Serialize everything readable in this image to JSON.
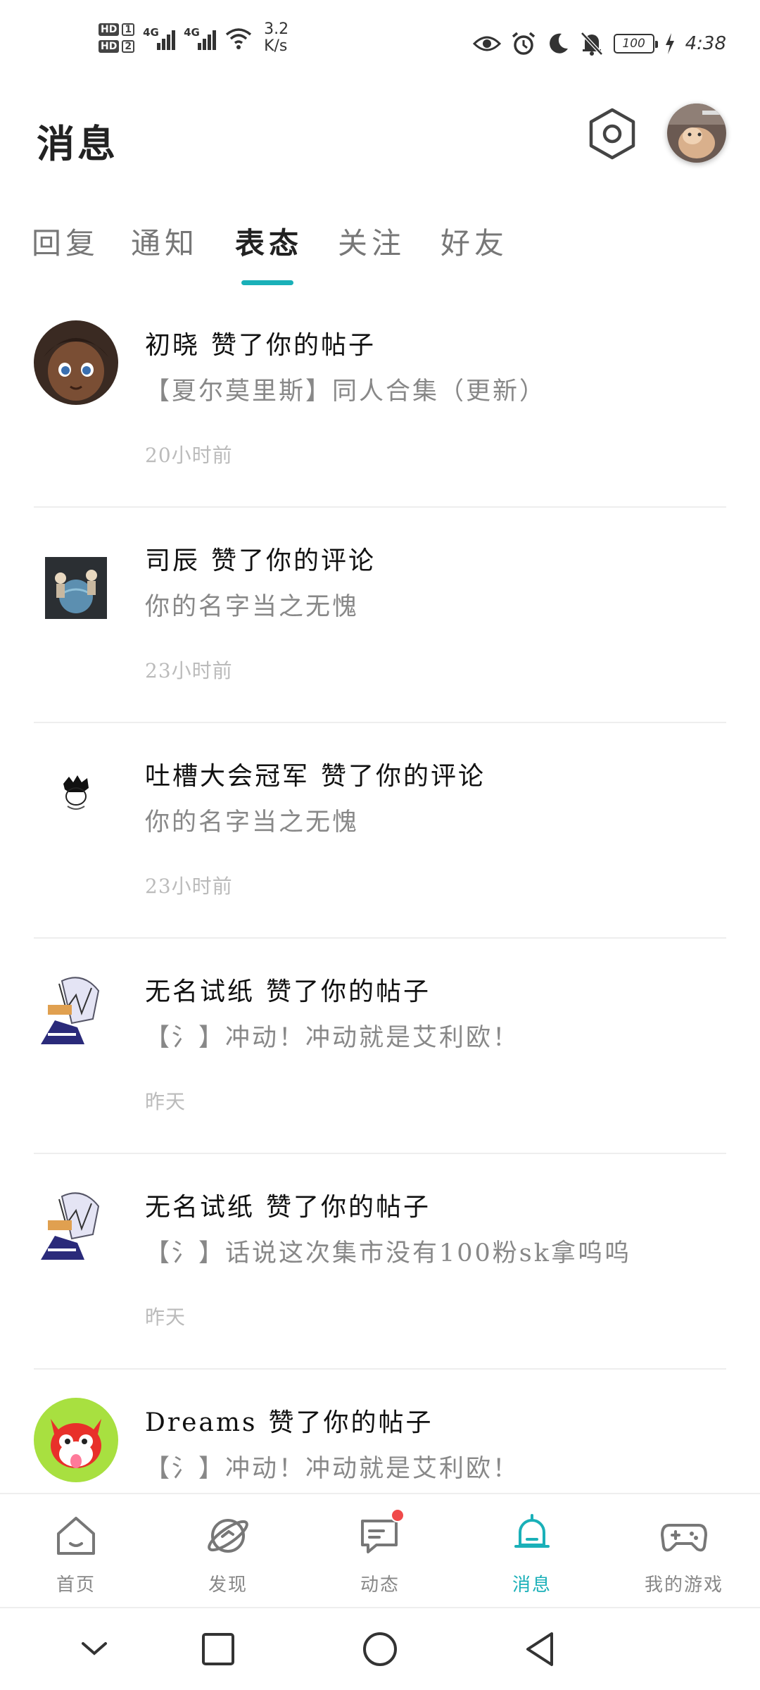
{
  "status_bar": {
    "hd1": "HD",
    "hd1_num": "1",
    "hd2": "HD",
    "hd2_num": "2",
    "net1": "4G",
    "net2": "4G",
    "speed_value": "3.2",
    "speed_unit": "K/s",
    "battery": "100",
    "time": "4:38",
    "icons": [
      "eye-icon",
      "alarm-icon",
      "moon-icon",
      "bell-off-icon",
      "battery-icon",
      "charging-icon"
    ]
  },
  "header": {
    "title": "消息",
    "settings_icon": "hexagon-settings-icon",
    "avatar_icon": "user-avatar"
  },
  "tabs": [
    {
      "label": "回复",
      "active": false
    },
    {
      "label": "通知",
      "active": false
    },
    {
      "label": "表态",
      "active": true
    },
    {
      "label": "关注",
      "active": false
    },
    {
      "label": "好友",
      "active": false
    }
  ],
  "accent_color": "#1ab0b8",
  "items": [
    {
      "name": "初晓",
      "action": "赞了你的帖子",
      "content": "【夏尔莫里斯】同人合集（更新）",
      "time": "20小时前"
    },
    {
      "name": "司辰",
      "action": "赞了你的评论",
      "content": "你的名字当之无愧",
      "time": "23小时前"
    },
    {
      "name": "吐槽大会冠军",
      "action": "赞了你的评论",
      "content": "你的名字当之无愧",
      "time": "23小时前"
    },
    {
      "name": "无名试纸",
      "action": "赞了你的帖子",
      "content": "【氵】冲动！冲动就是艾利欧！",
      "time": "昨天"
    },
    {
      "name": "无名试纸",
      "action": "赞了你的帖子",
      "content": "【氵】话说这次集市没有100粉sk拿呜呜",
      "time": "昨天"
    },
    {
      "name": "Dreams",
      "action": "赞了你的帖子",
      "content": "【氵】冲动！冲动就是艾利欧！",
      "time": ""
    }
  ],
  "bottom_nav": [
    {
      "label": "首页",
      "icon": "home-icon",
      "active": false
    },
    {
      "label": "发现",
      "icon": "planet-icon",
      "active": false
    },
    {
      "label": "动态",
      "icon": "message-icon",
      "active": false,
      "badge": true
    },
    {
      "label": "消息",
      "icon": "bell-icon",
      "active": true
    },
    {
      "label": "我的游戏",
      "icon": "gamepad-icon",
      "active": false
    }
  ],
  "system_nav": [
    "collapse-icon",
    "recents-icon",
    "home-circle-icon",
    "back-icon"
  ]
}
